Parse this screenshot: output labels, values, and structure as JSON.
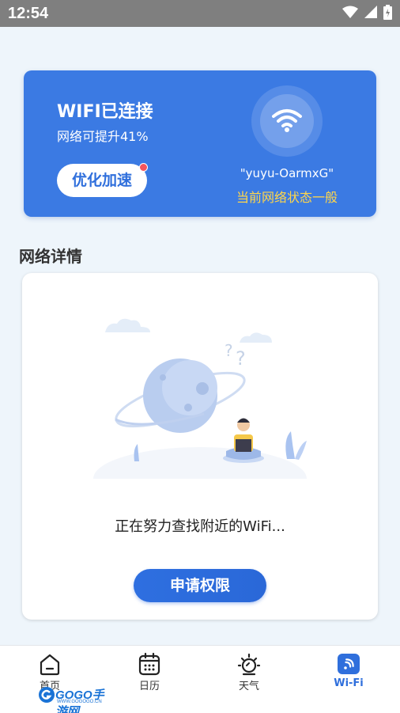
{
  "status_bar": {
    "time": "12:54",
    "icons": [
      "wifi-icon",
      "signal-icon",
      "battery-icon"
    ]
  },
  "wifi_card": {
    "title": "WIFI已连接",
    "subtitle": "网络可提升41%",
    "boost_label": "优化加速",
    "ssid": "\"yuyu-OarmxG\"",
    "network_status": "当前网络状态一般"
  },
  "details": {
    "section_title": "网络详情",
    "searching_text": "正在努力查找附近的WiFi...",
    "request_label": "申请权限"
  },
  "tabs": [
    {
      "label": "首页",
      "icon": "home-icon"
    },
    {
      "label": "日历",
      "icon": "calendar-icon"
    },
    {
      "label": "天气",
      "icon": "weather-icon"
    },
    {
      "label": "Wi-Fi",
      "icon": "wifi-tab-icon",
      "active": true
    }
  ],
  "watermark": {
    "brand": "GOGO手游网",
    "sub": "WWW.GOGOGO.CN"
  },
  "colors": {
    "accent": "#3b7ae3",
    "status_highlight": "#ffd64a",
    "badge": "#f5555d",
    "status_bar": "#7f7f7f",
    "background": "#eef5fb"
  }
}
